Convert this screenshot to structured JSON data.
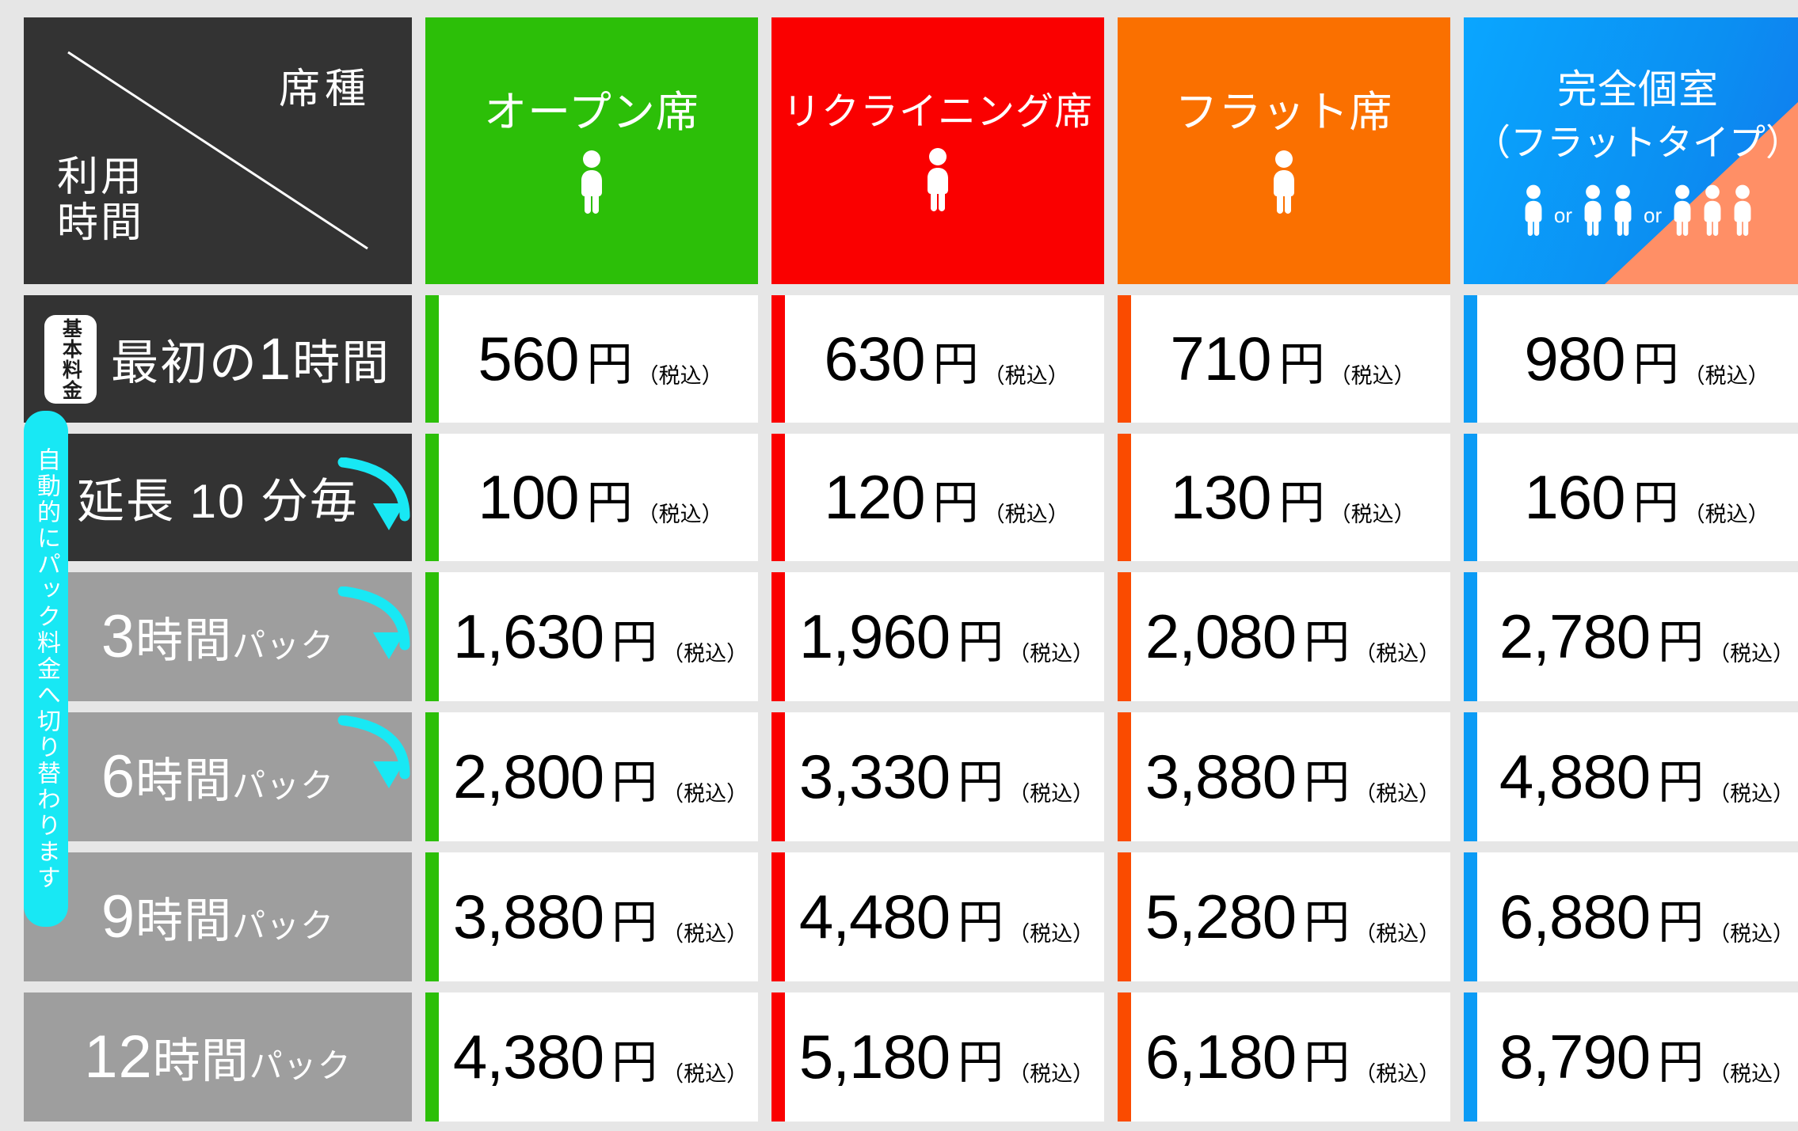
{
  "table": {
    "corner": {
      "seat_label": "席種",
      "time_label_line1": "利用",
      "time_label_line2": "時間"
    },
    "columns": [
      {
        "id": "open",
        "title": "オープン席",
        "subtitle": "",
        "color": "#2cbf08",
        "icon_groups": [
          1
        ],
        "or_label": ""
      },
      {
        "id": "reclining",
        "title": "リクライニング席",
        "subtitle": "",
        "color": "#fa0000",
        "icon_groups": [
          1
        ],
        "or_label": ""
      },
      {
        "id": "flat",
        "title": "フラット席",
        "subtitle": "",
        "color": "#fa7000",
        "icon_groups": [
          1
        ],
        "or_label": ""
      },
      {
        "id": "private",
        "title": "完全個室",
        "subtitle": "（フラットタイプ）",
        "color": "#0b9bf5",
        "color_alt": "#ff8f66",
        "icon_groups": [
          1,
          2,
          3
        ],
        "or_label": "or"
      }
    ],
    "rows": [
      {
        "id": "first-hour",
        "style": "dark",
        "badge": "基本料金",
        "label_parts": [
          {
            "text": "最初の",
            "size": "normal"
          },
          {
            "text": "1",
            "size": "big"
          },
          {
            "text": "時間",
            "size": "normal"
          }
        ],
        "prices": [
          "560",
          "630",
          "710",
          "980"
        ]
      },
      {
        "id": "extension",
        "style": "dark",
        "badge": "",
        "label_parts": [
          {
            "text": "延長 10 分毎",
            "size": "normal"
          }
        ],
        "prices": [
          "100",
          "120",
          "130",
          "160"
        ]
      },
      {
        "id": "pack-3h",
        "style": "pack",
        "pack_number": "3",
        "pack_hour": "時間",
        "pack_suffix": "パック",
        "prices": [
          "1,630",
          "1,960",
          "2,080",
          "2,780"
        ]
      },
      {
        "id": "pack-6h",
        "style": "pack",
        "pack_number": "6",
        "pack_hour": "時間",
        "pack_suffix": "パック",
        "prices": [
          "2,800",
          "3,330",
          "3,880",
          "4,880"
        ]
      },
      {
        "id": "pack-9h",
        "style": "pack",
        "pack_number": "9",
        "pack_hour": "時間",
        "pack_suffix": "パック",
        "prices": [
          "3,880",
          "4,480",
          "5,280",
          "6,880"
        ]
      },
      {
        "id": "pack-12h",
        "style": "pack",
        "pack_number": "12",
        "pack_hour": " 時間",
        "pack_suffix": "パック",
        "prices": [
          "4,380",
          "5,180",
          "6,180",
          "8,790"
        ]
      }
    ],
    "currency_unit": "円",
    "tax_note": "（税込）",
    "auto_switch_note": "自動的にパック料金へ切り替わります",
    "colors": {
      "background": "#e6e6e6",
      "dark_cell": "#333333",
      "pack_cell": "#9e9e9e",
      "cyan": "#18e8f4",
      "white": "#ffffff"
    }
  }
}
